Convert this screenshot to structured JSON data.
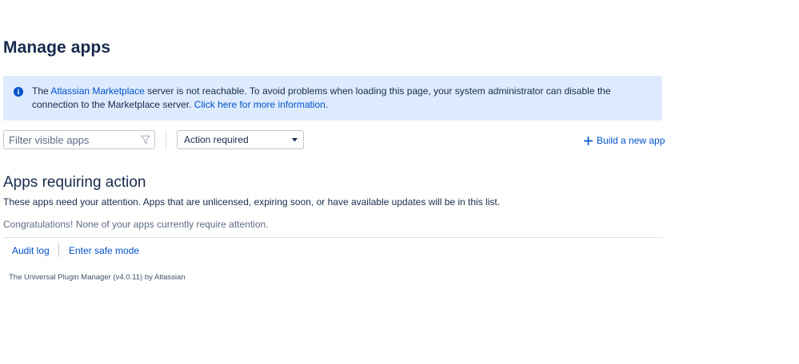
{
  "page": {
    "title": "Manage apps"
  },
  "banner": {
    "text_before": "The ",
    "marketplace_link": "Atlassian Marketplace",
    "text_middle": " server is not reachable. To avoid problems when loading this page, your system administrator can disable the connection to the Marketplace server. ",
    "info_link": "Click here for more information",
    "text_after": ".",
    "icon": "info-icon",
    "color": "#deebff"
  },
  "filters": {
    "search_placeholder": "Filter visible apps",
    "search_value": "",
    "search_icon": "filter-icon",
    "status_selected": "Action required",
    "build_app_label": "Build a new app"
  },
  "section": {
    "title": "Apps requiring action",
    "description": "These apps need your attention. Apps that are unlicensed, expiring soon, or have available updates will be in this list.",
    "empty_message": "Congratulations! None of your apps currently require attention."
  },
  "footer": {
    "audit_log": "Audit log",
    "safe_mode": "Enter safe mode",
    "version": "The Universal Plugin Manager (v4.0.11) by Atlassian"
  },
  "colors": {
    "link": "#0052cc",
    "heading": "#172b4d"
  }
}
